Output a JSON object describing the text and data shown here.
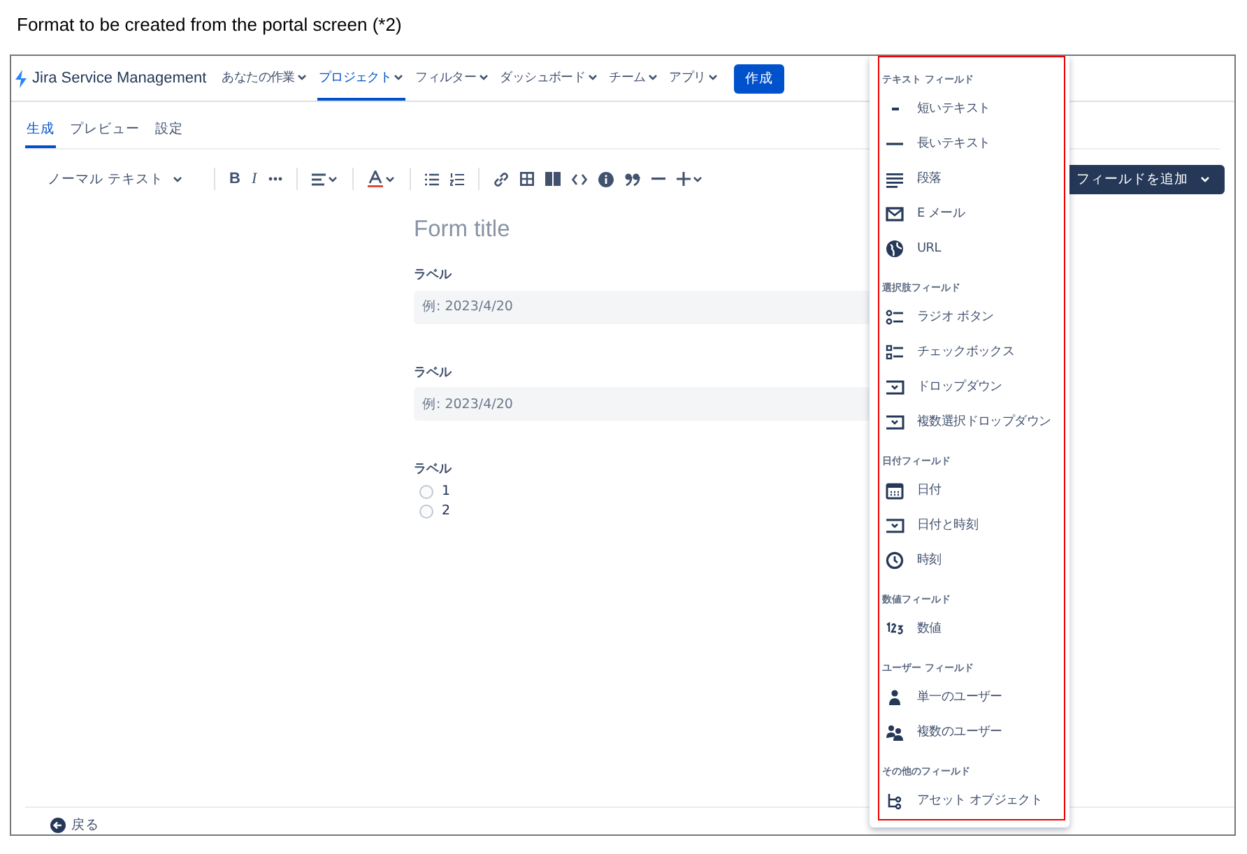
{
  "caption": "Format to be created from the portal screen (*2)",
  "nav": {
    "logo": "Jira Service Management",
    "items": [
      {
        "label": "あなたの作業",
        "selected": false
      },
      {
        "label": "プロジェクト",
        "selected": true
      },
      {
        "label": "フィルター",
        "selected": false
      },
      {
        "label": "ダッシュボード",
        "selected": false
      },
      {
        "label": "チーム",
        "selected": false
      },
      {
        "label": "アプリ",
        "selected": false
      }
    ],
    "create_button": "作成"
  },
  "tabs": [
    {
      "label": "生成",
      "selected": true
    },
    {
      "label": "プレビュー",
      "selected": false
    },
    {
      "label": "設定",
      "selected": false
    }
  ],
  "toolbar": {
    "text_style": "ノーマル テキスト",
    "bold": "B",
    "italic": "I",
    "add_field_button": "フィールドを追加"
  },
  "form": {
    "title": "Form title",
    "fields": [
      {
        "kind": "text",
        "label": "ラベル",
        "placeholder": "例: 2023/4/20"
      },
      {
        "kind": "text",
        "label": "ラベル",
        "placeholder": "例: 2023/4/20"
      },
      {
        "kind": "radio",
        "label": "ラベル",
        "options": [
          {
            "label": "1",
            "selected": false
          },
          {
            "label": "2",
            "selected": false
          }
        ]
      }
    ]
  },
  "field_menu": {
    "sections": [
      {
        "heading": "テキスト フィールド",
        "items": [
          {
            "kind": "short",
            "label": "短いテキスト"
          },
          {
            "kind": "long",
            "label": "長いテキスト"
          },
          {
            "kind": "paragraph",
            "label": "段落"
          },
          {
            "kind": "email",
            "label": "E メール"
          },
          {
            "kind": "url",
            "label": "URL"
          }
        ]
      },
      {
        "heading": "選択肢フィールド",
        "items": [
          {
            "kind": "radio",
            "label": "ラジオ ボタン"
          },
          {
            "kind": "checkbox",
            "label": "チェックボックス"
          },
          {
            "kind": "dropdown",
            "label": "ドロップダウン"
          },
          {
            "kind": "dropdown",
            "label": "複数選択ドロップダウン"
          }
        ]
      },
      {
        "heading": "日付フィールド",
        "items": [
          {
            "kind": "date",
            "label": "日付"
          },
          {
            "kind": "dropdown",
            "label": "日付と時刻"
          },
          {
            "kind": "time",
            "label": "時刻"
          }
        ]
      },
      {
        "heading": "数値フィールド",
        "items": [
          {
            "kind": "number",
            "label": "数値"
          }
        ]
      },
      {
        "heading": "ユーザー フィールド",
        "items": [
          {
            "kind": "user",
            "label": "単一のユーザー"
          },
          {
            "kind": "users",
            "label": "複数のユーザー"
          }
        ]
      },
      {
        "heading": "その他のフィールド",
        "items": [
          {
            "kind": "asset",
            "label": "アセット オブジェクト"
          }
        ]
      }
    ]
  },
  "back_link": "戻る"
}
